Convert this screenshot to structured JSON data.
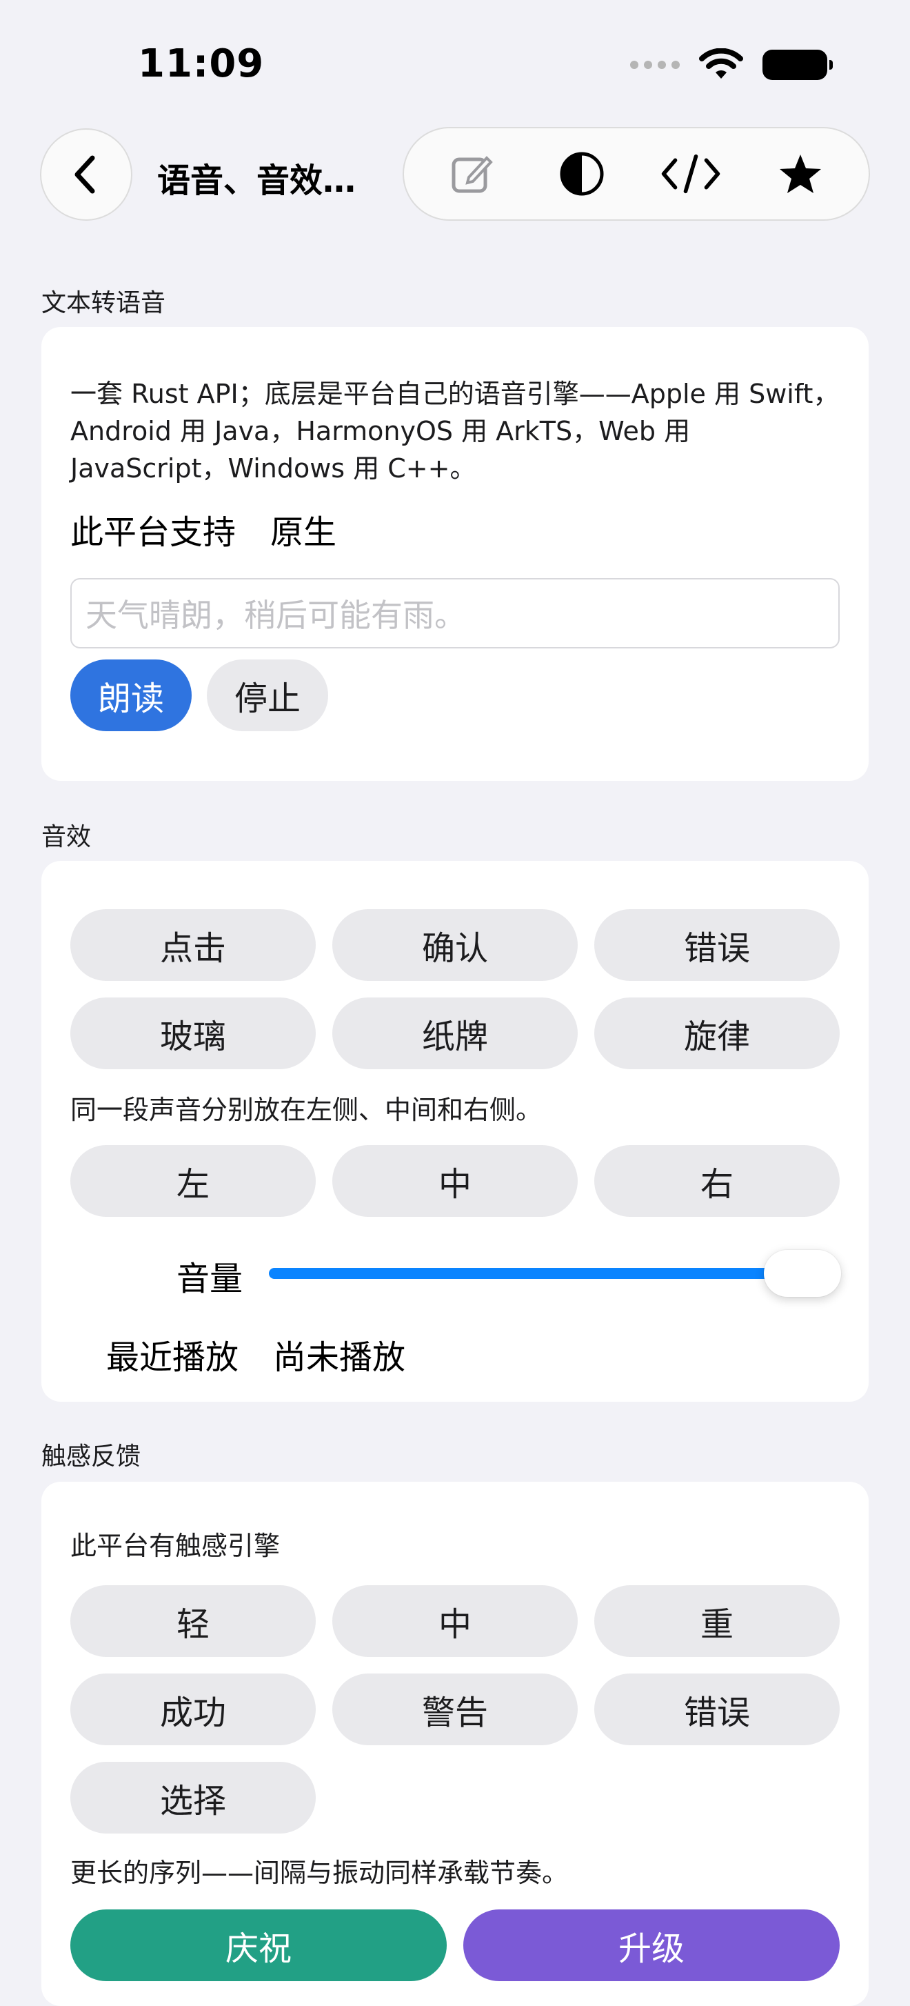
{
  "status_bar": {
    "time": "11:09"
  },
  "nav": {
    "title": "语音、音效…"
  },
  "tts": {
    "section_label": "文本转语音",
    "description": "一套 Rust API；底层是平台自己的语音引擎——Apple 用 Swift，Android 用 Java，HarmonyOS 用 ArkTS，Web 用 JavaScript，Windows 用 C++。",
    "support_label": "此平台支持",
    "support_value": "原生",
    "input_placeholder": "天气晴朗，稍后可能有雨。",
    "speak_label": "朗读",
    "stop_label": "停止",
    "accent": "#2f74e0"
  },
  "sfx": {
    "section_label": "音效",
    "buttons": [
      "点击",
      "确认",
      "错误",
      "玻璃",
      "纸牌",
      "旋律"
    ],
    "pan_note": "同一段声音分别放在左侧、中间和右侧。",
    "pan_buttons": [
      "左",
      "中",
      "右"
    ],
    "volume_label": "音量",
    "volume_value": 1.0,
    "recent_label": "最近播放",
    "recent_value": "尚未播放"
  },
  "haptics": {
    "section_label": "触感反馈",
    "engine_note": "此平台有触感引擎",
    "buttons": [
      "轻",
      "中",
      "重",
      "成功",
      "警告",
      "错误",
      "选择"
    ],
    "sequence_note": "更长的序列——间隔与振动同样承载节奏。",
    "celebrate_label": "庆祝",
    "levelup_label": "升级",
    "celebrate_color": "#22a085",
    "levelup_color": "#7b5ad6"
  }
}
